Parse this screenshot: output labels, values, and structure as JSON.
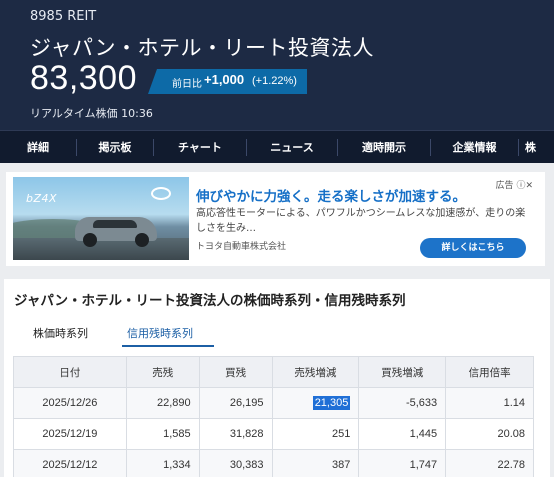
{
  "header": {
    "code": "8985  REIT",
    "name": "ジャパン・ホテル・リート投資法人",
    "price": "83,300",
    "change_label": "前日比",
    "change_value": "+1,000",
    "change_pct": "(+1.22%)",
    "realtime": "リアルタイム株価  10:36"
  },
  "nav": [
    "詳細",
    "掲示板",
    "チャート",
    "ニュース",
    "適時開示",
    "企業情報",
    "株"
  ],
  "ad": {
    "brand": "bZ4X",
    "headline": "伸びやかに力強く。走る楽しさが加速する。",
    "tag": "広告",
    "body": "高応答性モーターによる、パワフルかつシームレスな加速感が、走りの楽しさを生み…",
    "sponsor": "トヨタ自動車株式会社",
    "button": "詳しくはこちら"
  },
  "section": {
    "title": "ジャパン・ホテル・リート投資法人の株価時系列・信用残時系列",
    "tabs": [
      "株価時系列",
      "信用残時系列"
    ],
    "active_tab": "信用残時系列"
  },
  "table": {
    "headers": [
      "日付",
      "売残",
      "買残",
      "売残増減",
      "買残増減",
      "信用倍率"
    ],
    "rows": [
      [
        "2025/12/26",
        "22,890",
        "26,195",
        "21,305",
        "-5,633",
        "1.14"
      ],
      [
        "2025/12/19",
        "1,585",
        "31,828",
        "251",
        "1,445",
        "20.08"
      ],
      [
        "2025/12/12",
        "1,334",
        "30,383",
        "387",
        "1,747",
        "22.78"
      ]
    ]
  }
}
